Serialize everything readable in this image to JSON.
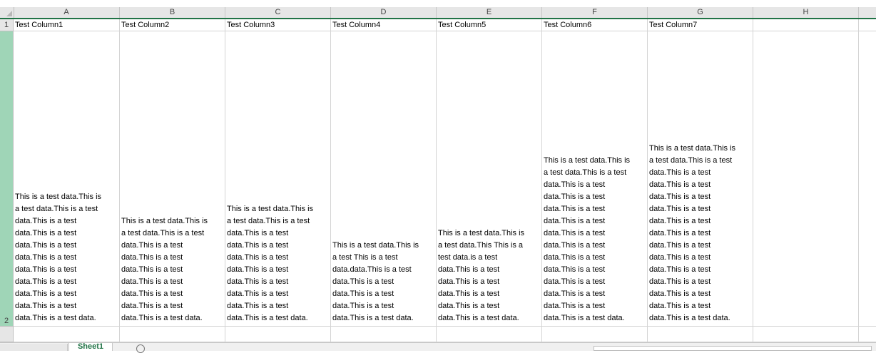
{
  "columns": [
    "A",
    "B",
    "C",
    "D",
    "E",
    "F",
    "G",
    "H"
  ],
  "rows": [
    "1",
    "2"
  ],
  "headers": [
    "Test Column1",
    "Test Column2",
    "Test Column3",
    "Test Column4",
    "Test Column5",
    "Test Column6",
    "Test Column7"
  ],
  "cells": [
    [
      "This is a test data.This is",
      "a test data.This is a test",
      "data.This is a test",
      "data.This is a test",
      "data.This is a test",
      "data.This is a test",
      "data.This is a test",
      "data.This is a test",
      "data.This is a test",
      "data.This is a test",
      "data.This is a test data."
    ],
    [
      "This is a test data.This is",
      "a test data.This is a test",
      "data.This is a test",
      "data.This is a test",
      "data.This is a test",
      "data.This is a test",
      "data.This is a test",
      "data.This is a test",
      "data.This is a test data."
    ],
    [
      "This is a test data.This is",
      "a test data.This is a test",
      "data.This is a test",
      "data.This is a test",
      "data.This is a test",
      "data.This is a test",
      "data.This is a test",
      "data.This is a test",
      "data.This is a test",
      "data.This is a test data."
    ],
    [
      "This is a test data.This is",
      "a test This is a test",
      "data.data.This is a test",
      "data.This is a test",
      "data.This is a test",
      "data.This is a test",
      "data.This is a test data."
    ],
    [
      "This is a test data.This is",
      "a test data.This This is a",
      "test data.is a test",
      "data.This is a test",
      "data.This is a test",
      "data.This is a test",
      "data.This is a test",
      "data.This is a test data."
    ],
    [
      "This is a test data.This is",
      "a test data.This is a test",
      "data.This is a test",
      "data.This is a test",
      "data.This is a test",
      "data.This is a test",
      "data.This is a test",
      "data.This is a test",
      "data.This is a test",
      "data.This is a test",
      "data.This is a test",
      "data.This is a test",
      "data.This is a test",
      "data.This is a test data."
    ],
    [
      "This is a test data.This is",
      "a test data.This is a test",
      "data.This is a test",
      "data.This is a test",
      "data.This is a test",
      "data.This is a test",
      "data.This is a test",
      "data.This is a test",
      "data.This is a test",
      "data.This is a test",
      "data.This is a test",
      "data.This is a test",
      "data.This is a test",
      "data.This is a test",
      "data.This is a test data."
    ]
  ],
  "sheet_tab": "Sheet1",
  "colors": {
    "accent": "#217346",
    "selected_row": "#9fd5b7"
  }
}
